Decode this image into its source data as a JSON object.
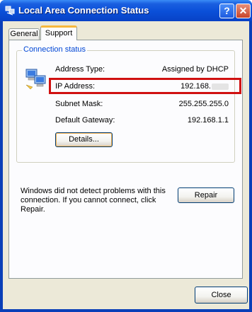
{
  "window": {
    "title": "Local Area Connection Status",
    "help_label": "?",
    "close_label": "✕"
  },
  "tabs": [
    {
      "label": "General"
    },
    {
      "label": "Support"
    }
  ],
  "connection_status": {
    "group_label": "Connection status",
    "rows": [
      {
        "label": "Address Type:",
        "value": "Assigned by DHCP"
      },
      {
        "label": "IP Address:",
        "value": "192.168."
      },
      {
        "label": "Subnet Mask:",
        "value": "255.255.255.0"
      },
      {
        "label": "Default Gateway:",
        "value": "192.168.1.1"
      }
    ],
    "details_button": "Details..."
  },
  "diagnostics": {
    "text": "Windows did not detect problems with this connection. If you cannot connect, click Repair.",
    "repair_button": "Repair"
  },
  "footer": {
    "close_button": "Close"
  },
  "colors": {
    "highlight": "#d01010",
    "group_label": "#0046d5",
    "tab_accent": "#f7b83c"
  }
}
